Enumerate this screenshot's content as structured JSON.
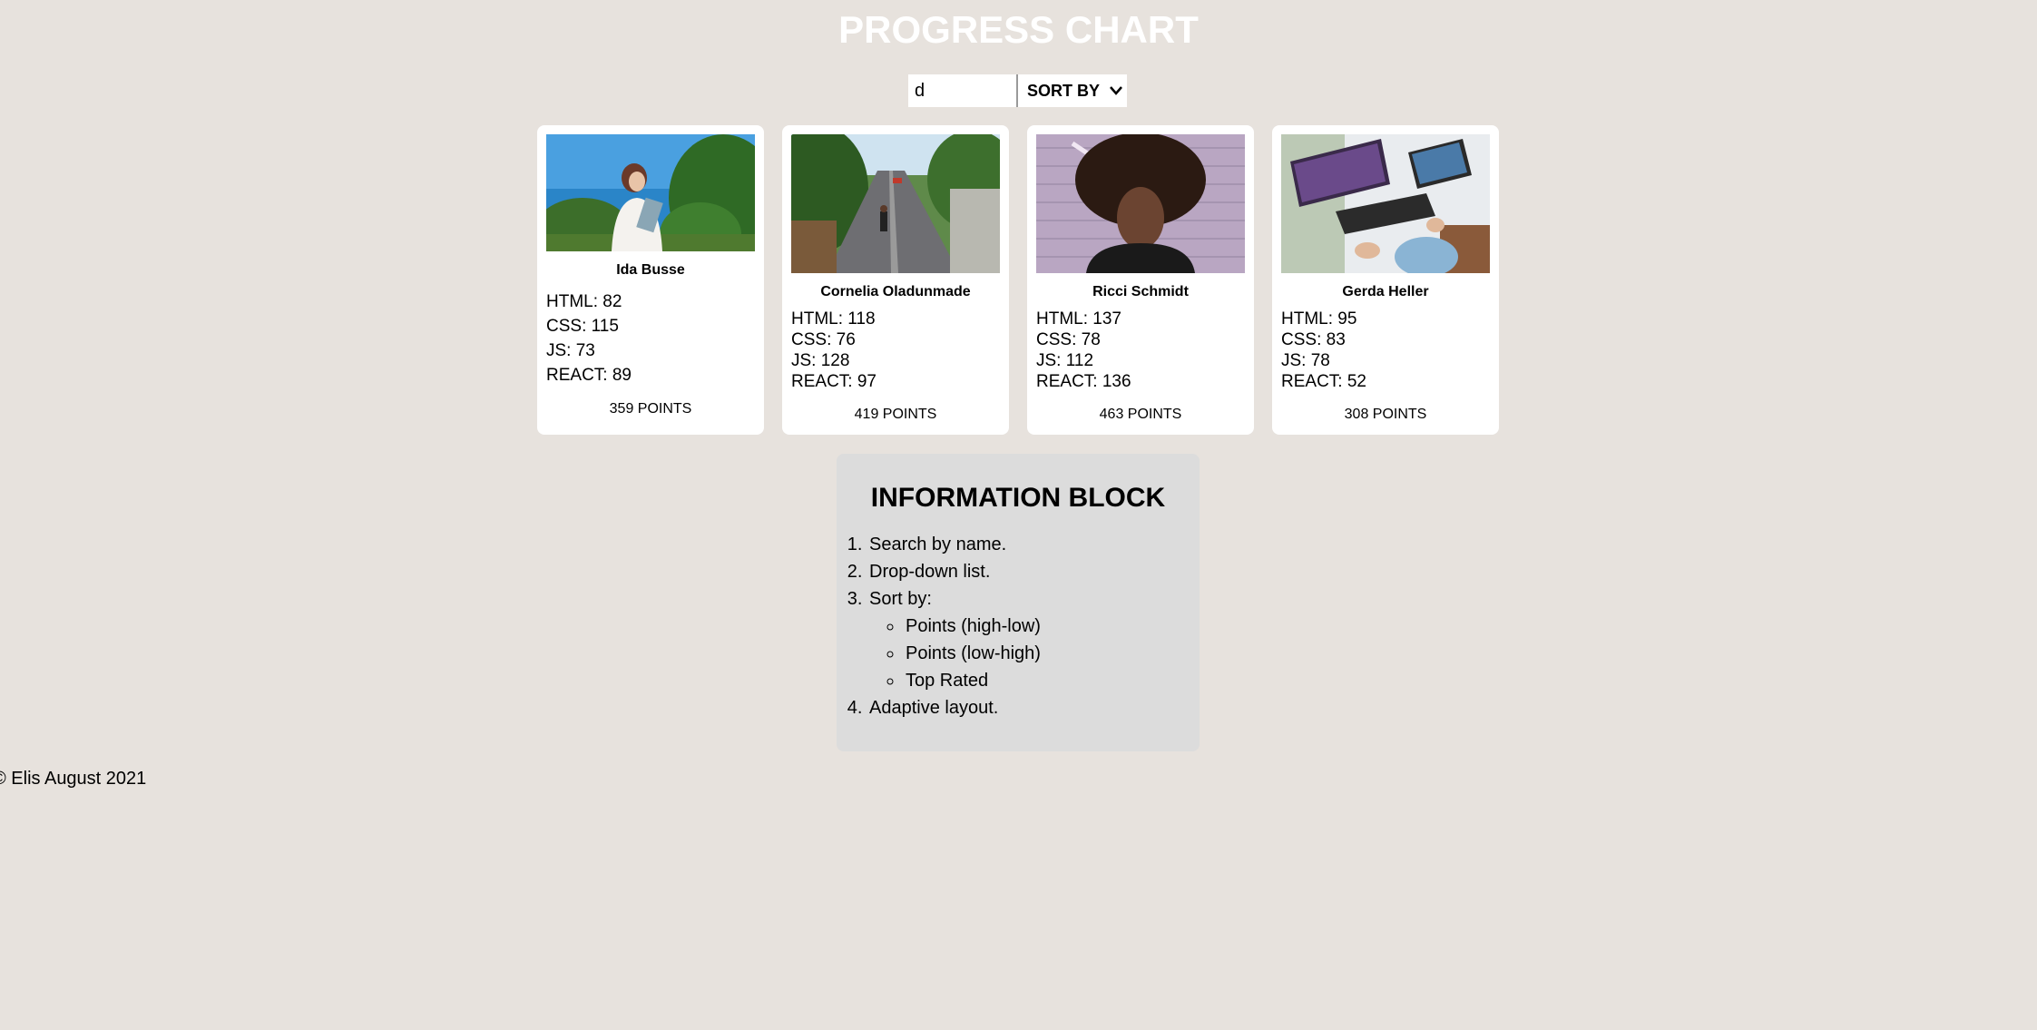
{
  "header": {
    "title": "PROGRESS CHART"
  },
  "controls": {
    "search_value": "d",
    "sort_label": "SORT BY",
    "sort_icon": "chevron-down-icon"
  },
  "cards": [
    {
      "name": "Ida Busse",
      "photo": "woman-reading-photo",
      "stats": [
        "HTML: 82",
        "CSS: 115",
        "JS: 73",
        "REACT: 89"
      ],
      "points": "359 POINTS"
    },
    {
      "name": "Cornelia Oladunmade",
      "photo": "street-walker-photo",
      "stats": [
        "HTML: 118",
        "CSS: 76",
        "JS: 128",
        "REACT: 97"
      ],
      "points": "419 POINTS"
    },
    {
      "name": "Ricci Schmidt",
      "photo": "portrait-man-photo",
      "stats": [
        "HTML: 137",
        "CSS: 78",
        "JS: 112",
        "REACT: 136"
      ],
      "points": "463 POINTS"
    },
    {
      "name": "Gerda Heller",
      "photo": "desk-workspace-photo",
      "stats": [
        "HTML: 95",
        "CSS: 83",
        "JS: 78",
        "REACT: 52"
      ],
      "points": "308 POINTS"
    }
  ],
  "info": {
    "title": "INFORMATION BLOCK",
    "items": [
      "Search by name.",
      "Drop-down list.",
      "Sort by:",
      "Adaptive layout."
    ],
    "sort_options": [
      "Points (high-low)",
      "Points (low-high)",
      "Top Rated"
    ]
  },
  "footer": {
    "text": "© Elis August 2021"
  },
  "colors": {
    "background": "#e7e2dd",
    "card": "#ffffff",
    "info_block": "#dcdcdc",
    "title": "#ffffff"
  }
}
